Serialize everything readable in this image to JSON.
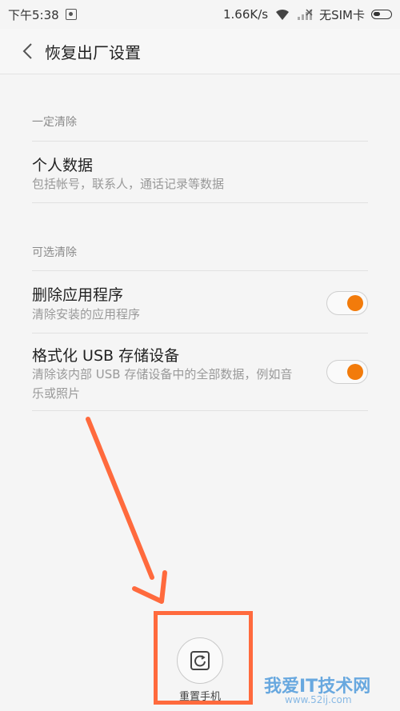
{
  "status_bar": {
    "time": "下午5:38",
    "speed": "1.66K/s",
    "sim": "无SIM卡"
  },
  "header": {
    "title": "恢复出厂设置"
  },
  "sections": [
    {
      "label": "一定清除"
    },
    {
      "label": "可选清除"
    }
  ],
  "items": [
    {
      "title": "个人数据",
      "desc": "包括帐号，联系人，通话记录等数据"
    },
    {
      "title": "删除应用程序",
      "desc": "清除安装的应用程序",
      "toggle": true
    },
    {
      "title": "格式化 USB 存储设备",
      "desc": "清除该内部 USB 存储设备中的全部数据，例如音乐或照片",
      "toggle": true
    }
  ],
  "reset_button": {
    "label": "重置手机"
  },
  "watermark": {
    "text": "我爱IT技术网",
    "sub": "www.52ij.com"
  },
  "colors": {
    "accent": "#f27b0b",
    "annotation": "#ff6a3d"
  }
}
